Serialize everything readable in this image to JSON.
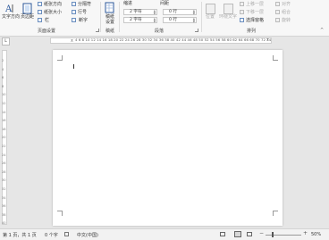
{
  "ribbon": {
    "text_direction": "文字方向",
    "margins": "页边距",
    "orientation": "纸张方向",
    "size": "纸张大小",
    "columns": "栏",
    "breaks": "分隔符",
    "line_numbers": "行号",
    "hyphenation": "断字",
    "page_setup_group": "页面设置",
    "manuscript_line1": "稿纸",
    "manuscript_line2": "设置",
    "manuscript_group": "稿纸",
    "indent_label": "缩进",
    "spacing_label": "间距",
    "indent_left_value": "2 字符",
    "indent_right_value": "2 字符",
    "spacing_before_value": "0 行",
    "spacing_after_value": "0 行",
    "paragraph_group": "段落",
    "position": "位置",
    "wrap_text": "环绕文字",
    "bring_forward": "上移一层",
    "send_backward": "下移一层",
    "selection_pane": "选择窗格",
    "align": "对齐",
    "group": "组合",
    "rotate": "旋转",
    "arrange_group": "排列"
  },
  "ruler": {
    "tab_marker": "L",
    "numbers": "4 6 8 10 12 14 16 18 20 22 24 26 28 30 32 34 36 38 40 42 44 46 48 50 52 54 56 58 60 62 64 66 68 70 72 74"
  },
  "vruler_numbers": [
    "2",
    "4",
    "6",
    "8",
    "10",
    "12",
    "14",
    "16",
    "18",
    "20",
    "22",
    "24",
    "26",
    "28",
    "30",
    "32",
    "34",
    "36",
    "38",
    "40"
  ],
  "status": {
    "page_info": "第 1 页，共 1 页",
    "word_count": "0 个字",
    "language": "中文(中国)",
    "zoom": "50%"
  },
  "colors": {
    "accent": "#2b579a",
    "ribbon_bg": "#f7f7f7",
    "canvas_bg": "#e6e6e6"
  }
}
